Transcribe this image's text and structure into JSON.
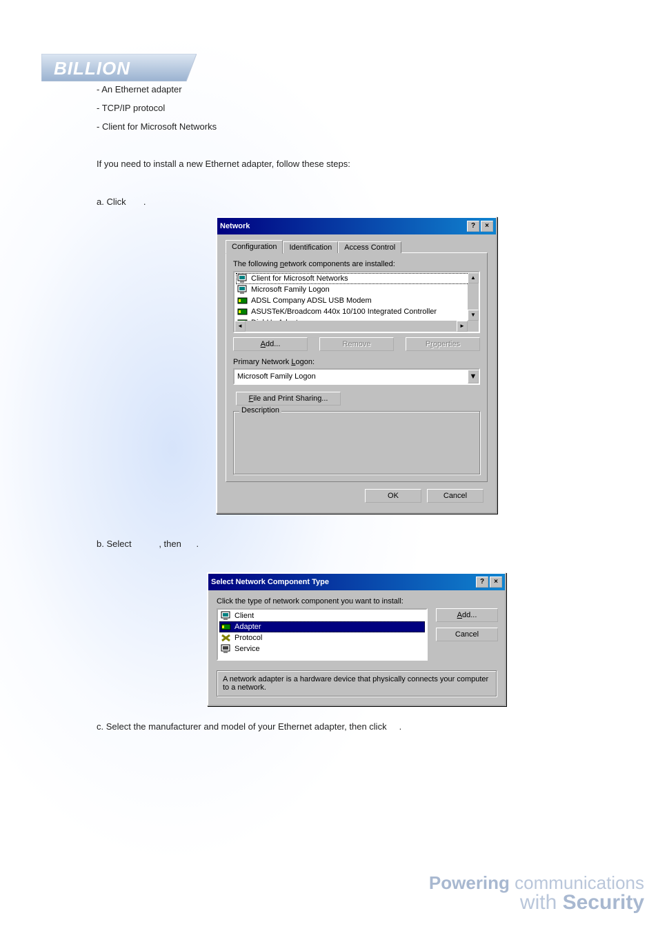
{
  "brand": "BILLION",
  "doc": {
    "bullets": [
      "- An Ethernet adapter",
      "- TCP/IP protocol",
      "- Client for Microsoft Networks"
    ],
    "intro": "If you need to install a new Ethernet adapter, follow these steps:",
    "step_a": "a. Click",
    "step_a_after": ".",
    "step_b_1": "b. Select",
    "step_b_2": ", then",
    "step_b_3": ".",
    "step_c": "c. Select the manufacturer and model of your Ethernet adapter, then click",
    "step_c_after": "."
  },
  "dlg_network": {
    "title": "Network",
    "tabs": [
      "Configuration",
      "Identification",
      "Access Control"
    ],
    "list_label_pre": "The following ",
    "list_label_u": "n",
    "list_label_post": "etwork components are installed:",
    "items": [
      "Client for Microsoft Networks",
      "Microsoft Family Logon",
      "ADSL Company ADSL USB Modem",
      "ASUSTeK/Broadcom 440x 10/100 Integrated Controller",
      "Dial-Up Adapter"
    ],
    "btn_add": "Add...",
    "btn_remove": "Remove",
    "btn_properties": "Properties",
    "primary_logon_pre": "Primary Network ",
    "primary_logon_u": "L",
    "primary_logon_post": "ogon:",
    "primary_logon_value": "Microsoft Family Logon",
    "btn_file_share": "File and Print Sharing...",
    "desc_label": "Description",
    "btn_ok": "OK",
    "btn_cancel": "Cancel"
  },
  "dlg_component": {
    "title": "Select Network Component Type",
    "instruction": "Click the type of network component you want to install:",
    "items": [
      "Client",
      "Adapter",
      "Protocol",
      "Service"
    ],
    "btn_add": "Add...",
    "btn_cancel": "Cancel",
    "desc": "A network adapter is a hardware device that physically connects your computer to a network."
  },
  "footer": {
    "line1a": "Powering",
    "line1b": " communications",
    "line2a": "with ",
    "line2b": "Security"
  }
}
